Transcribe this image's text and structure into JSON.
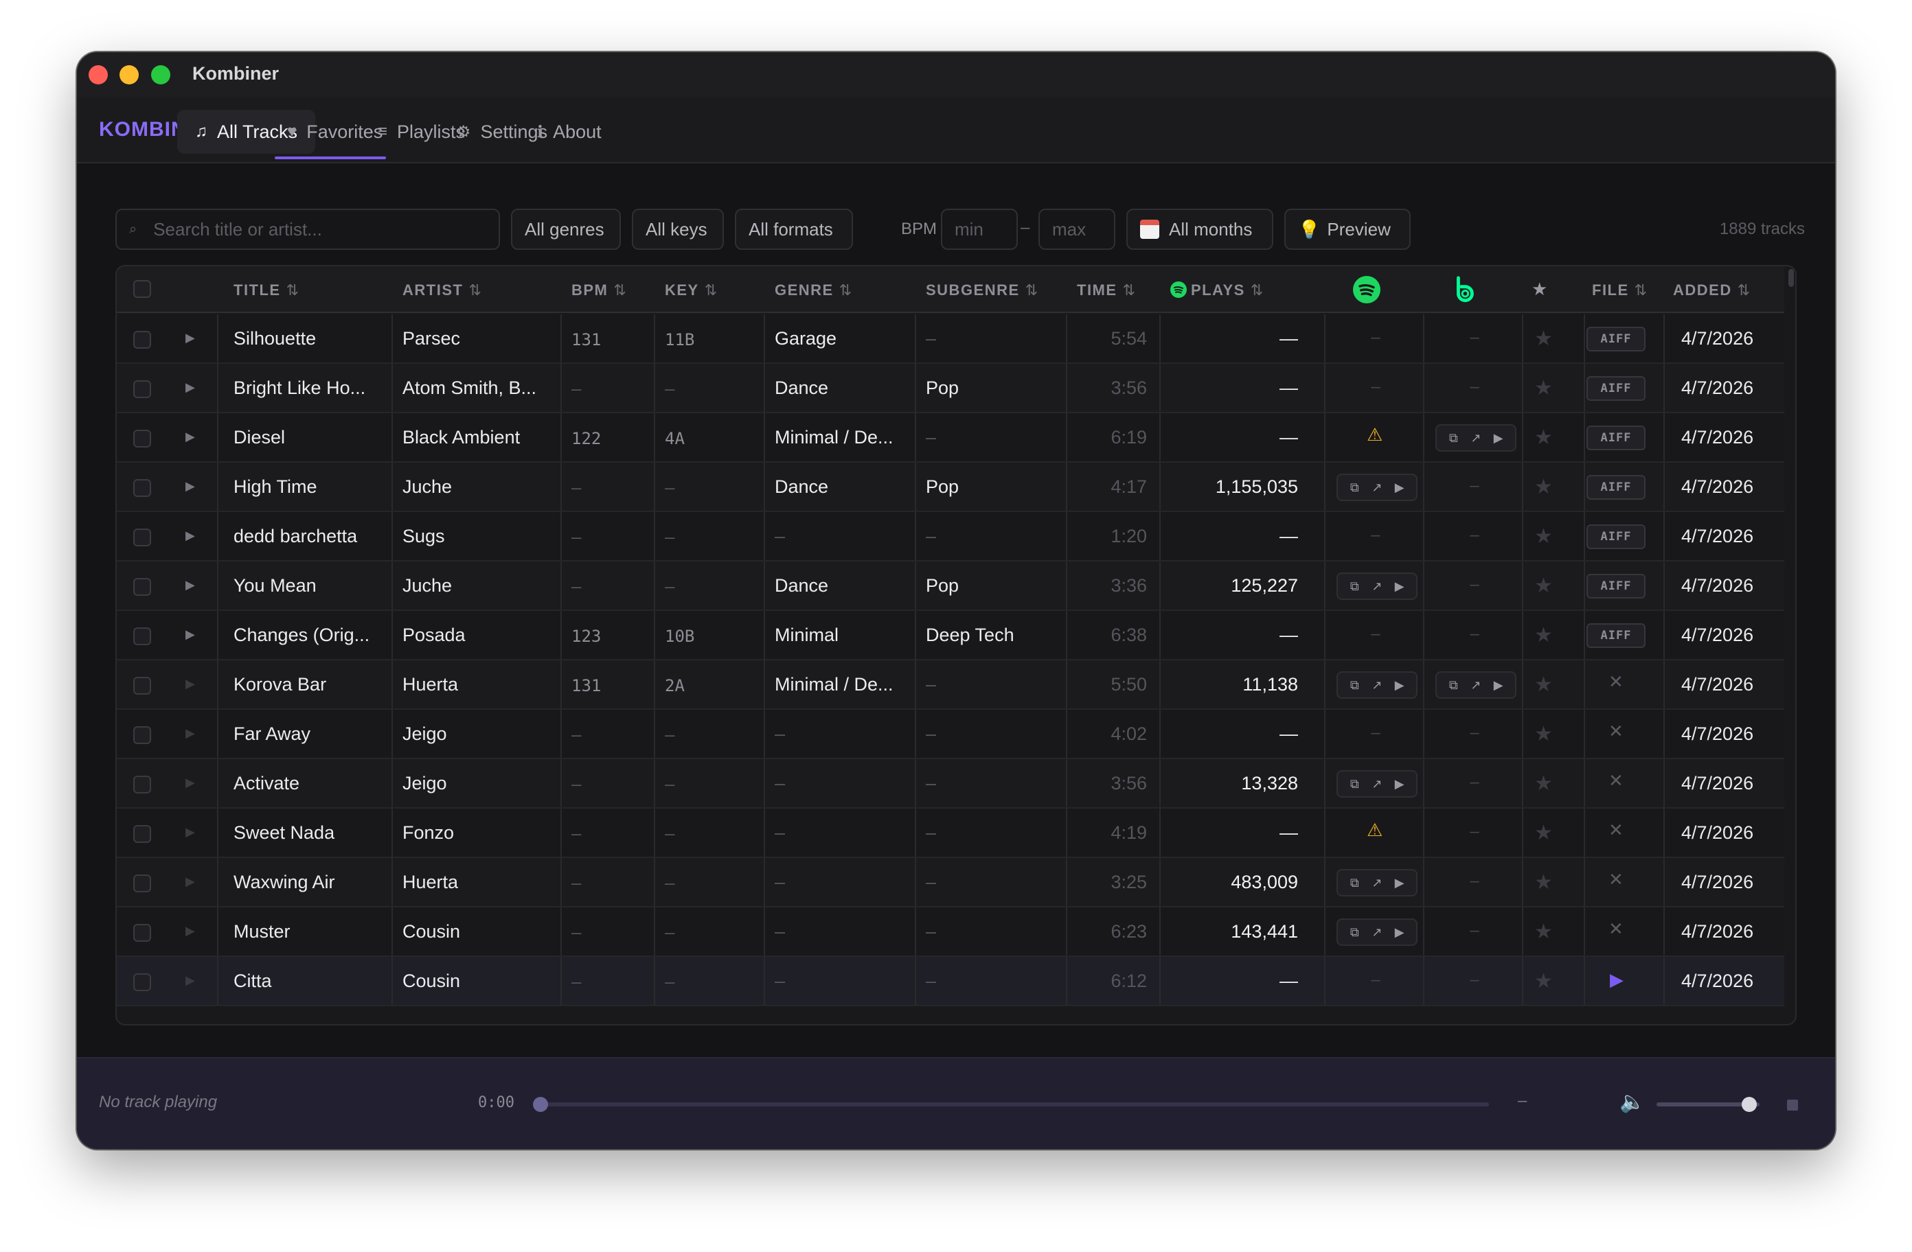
{
  "window": {
    "title": "Kombiner"
  },
  "nav": {
    "brand": "KOMBINER",
    "tabs": [
      {
        "label": "All Tracks",
        "icon": "music-note-icon",
        "active": true
      },
      {
        "label": "Favorites",
        "icon": "heart-icon"
      },
      {
        "label": "Playlists",
        "icon": "list-icon"
      },
      {
        "label": "Settings",
        "icon": "gear-icon"
      },
      {
        "label": "About",
        "icon": "info-icon"
      }
    ]
  },
  "filters": {
    "search_placeholder": "Search title or artist...",
    "genres": "All genres",
    "keys": "All keys",
    "formats": "All formats",
    "bpm_label": "BPM",
    "bpm_min_placeholder": "min",
    "bpm_max_placeholder": "max",
    "bpm_separator": "–",
    "months": "All months",
    "preview": "Preview",
    "track_count": "1889 tracks"
  },
  "table": {
    "headers": {
      "title": "TITLE",
      "artist": "ARTIST",
      "bpm": "BPM",
      "key": "KEY",
      "genre": "GENRE",
      "subgenre": "SUBGENRE",
      "time": "TIME",
      "plays": "PLAYS",
      "file": "FILE",
      "added": "ADDED",
      "sort_icon": "⇅",
      "star_icon": "★"
    },
    "rows": [
      {
        "title": "Silhouette",
        "artist": "Parsec",
        "bpm": "131",
        "key": "11B",
        "genre": "Garage",
        "subgenre": "–",
        "time": "5:54",
        "plays": "—",
        "spotify": "dash",
        "beatport": "dash",
        "file": "AIFF",
        "added": "4/7/2026"
      },
      {
        "title": "Bright Like Ho...",
        "artist": "Atom Smith, B...",
        "bpm": "–",
        "key": "–",
        "genre": "Dance",
        "subgenre": "Pop",
        "time": "3:56",
        "plays": "—",
        "spotify": "dash",
        "beatport": "dash",
        "file": "AIFF",
        "added": "4/7/2026"
      },
      {
        "title": "Diesel",
        "artist": "Black Ambient",
        "bpm": "122",
        "key": "4A",
        "genre": "Minimal / De...",
        "subgenre": "–",
        "time": "6:19",
        "plays": "—",
        "spotify": "warn",
        "beatport": "icons",
        "file": "AIFF",
        "added": "4/7/2026"
      },
      {
        "title": "High Time",
        "artist": "Juche",
        "bpm": "–",
        "key": "–",
        "genre": "Dance",
        "subgenre": "Pop",
        "time": "4:17",
        "plays": "1,155,035",
        "spotify": "icons",
        "beatport": "dash",
        "file": "AIFF",
        "added": "4/7/2026"
      },
      {
        "title": "dedd barchetta",
        "artist": "Sugs",
        "bpm": "–",
        "key": "–",
        "genre": "–",
        "subgenre": "–",
        "time": "1:20",
        "plays": "—",
        "spotify": "dash",
        "beatport": "dash",
        "file": "AIFF",
        "added": "4/7/2026"
      },
      {
        "title": "You Mean",
        "artist": "Juche",
        "bpm": "–",
        "key": "–",
        "genre": "Dance",
        "subgenre": "Pop",
        "time": "3:36",
        "plays": "125,227",
        "spotify": "icons",
        "beatport": "dash",
        "file": "AIFF",
        "added": "4/7/2026"
      },
      {
        "title": "Changes (Orig...",
        "artist": "Posada",
        "bpm": "123",
        "key": "10B",
        "genre": "Minimal",
        "subgenre": "Deep Tech",
        "time": "6:38",
        "plays": "—",
        "spotify": "dash",
        "beatport": "dash",
        "file": "AIFF",
        "added": "4/7/2026"
      },
      {
        "title": "Korova Bar",
        "artist": "Huerta",
        "bpm": "131",
        "key": "2A",
        "genre": "Minimal / De...",
        "subgenre": "–",
        "time": "5:50",
        "plays": "11,138",
        "spotify": "icons",
        "beatport": "icons",
        "file": "x",
        "added": "4/7/2026"
      },
      {
        "title": "Far Away",
        "artist": "Jeigo",
        "bpm": "–",
        "key": "–",
        "genre": "–",
        "subgenre": "–",
        "time": "4:02",
        "plays": "—",
        "spotify": "dash",
        "beatport": "dash",
        "file": "x",
        "added": "4/7/2026"
      },
      {
        "title": "Activate",
        "artist": "Jeigo",
        "bpm": "–",
        "key": "–",
        "genre": "–",
        "subgenre": "–",
        "time": "3:56",
        "plays": "13,328",
        "spotify": "icons",
        "beatport": "dash",
        "file": "x",
        "added": "4/7/2026"
      },
      {
        "title": "Sweet Nada",
        "artist": "Fonzo",
        "bpm": "–",
        "key": "–",
        "genre": "–",
        "subgenre": "–",
        "time": "4:19",
        "plays": "—",
        "spotify": "warn",
        "beatport": "dash",
        "file": "x",
        "added": "4/7/2026"
      },
      {
        "title": "Waxwing Air",
        "artist": "Huerta",
        "bpm": "–",
        "key": "–",
        "genre": "–",
        "subgenre": "–",
        "time": "3:25",
        "plays": "483,009",
        "spotify": "icons",
        "beatport": "dash",
        "file": "x",
        "added": "4/7/2026"
      },
      {
        "title": "Muster",
        "artist": "Cousin",
        "bpm": "–",
        "key": "–",
        "genre": "–",
        "subgenre": "–",
        "time": "6:23",
        "plays": "143,441",
        "spotify": "icons",
        "beatport": "dash",
        "file": "x",
        "added": "4/7/2026"
      },
      {
        "title": "Citta",
        "artist": "Cousin",
        "bpm": "–",
        "key": "–",
        "genre": "–",
        "subgenre": "–",
        "time": "6:12",
        "plays": "—",
        "spotify": "dash",
        "beatport": "dash",
        "file": "play",
        "added": "4/7/2026",
        "selected": true
      }
    ]
  },
  "player": {
    "status": "No track playing",
    "elapsed": "0:00",
    "duration": "–",
    "progress": 0,
    "volume": 0.9
  },
  "colors": {
    "accent": "#7c5cf0",
    "spotify": "#1ed760",
    "beatport": "#01ff95",
    "warning": "#f2b01e"
  }
}
